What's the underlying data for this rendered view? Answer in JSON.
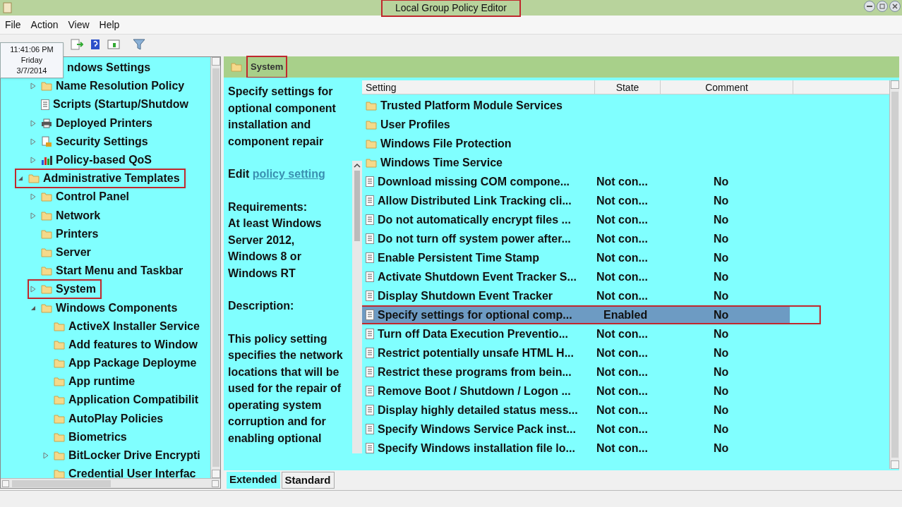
{
  "window": {
    "title": "Local Group Policy Editor",
    "title_highlighted": true
  },
  "menu": [
    "File",
    "Action",
    "View",
    "Help"
  ],
  "clock_tooltip": {
    "time": "11:41:06 PM",
    "day": "Friday",
    "date": "3/7/2014"
  },
  "tree": [
    {
      "label": "ndows Settings",
      "highlighted": false,
      "children": [
        {
          "label": "Name Resolution Policy",
          "kind": "folder",
          "expanded": false,
          "highlighted": false
        },
        {
          "label": "Scripts (Startup/Shutdow",
          "kind": "script",
          "highlighted": false
        },
        {
          "label": "Deployed Printers",
          "kind": "printer",
          "expanded": false,
          "highlighted": false
        },
        {
          "label": "Security Settings",
          "kind": "security",
          "expanded": false,
          "highlighted": false
        },
        {
          "label": "Policy-based QoS",
          "kind": "chart",
          "expanded": false,
          "highlighted": false
        }
      ]
    },
    {
      "label": "Administrative Templates",
      "kind": "folder",
      "expanded": true,
      "highlighted": true,
      "children": [
        {
          "label": "Control Panel",
          "kind": "folder",
          "expanded": false,
          "highlighted": false
        },
        {
          "label": "Network",
          "kind": "folder",
          "expanded": false,
          "highlighted": false
        },
        {
          "label": "Printers",
          "kind": "folder",
          "highlighted": false
        },
        {
          "label": "Server",
          "kind": "folder",
          "highlighted": false
        },
        {
          "label": "Start Menu and Taskbar",
          "kind": "folder",
          "highlighted": false
        },
        {
          "label": "System",
          "kind": "folder",
          "expanded": false,
          "highlighted": true
        },
        {
          "label": "Windows Components",
          "kind": "folder",
          "expanded": true,
          "highlighted": false,
          "children": [
            {
              "label": "ActiveX Installer Service",
              "kind": "folder",
              "highlighted": false
            },
            {
              "label": "Add features to Window",
              "kind": "folder",
              "highlighted": false
            },
            {
              "label": "App Package Deployme",
              "kind": "folder",
              "highlighted": false
            },
            {
              "label": "App runtime",
              "kind": "folder",
              "highlighted": false
            },
            {
              "label": "Application Compatibilit",
              "kind": "folder",
              "highlighted": false
            },
            {
              "label": "AutoPlay Policies",
              "kind": "folder",
              "highlighted": false
            },
            {
              "label": "Biometrics",
              "kind": "folder",
              "highlighted": false
            },
            {
              "label": "BitLocker Drive Encrypti",
              "kind": "folder",
              "expanded": false,
              "highlighted": false
            },
            {
              "label": "Credential User Interfac",
              "kind": "folder",
              "highlighted": false
            }
          ]
        }
      ]
    }
  ],
  "breadcrumb": {
    "label": "System",
    "highlighted": true
  },
  "description": {
    "title": "Specify settings for optional component installation and component repair",
    "edit_prefix": "Edit",
    "edit_link": "policy setting",
    "requirements_label": "Requirements:",
    "requirements": "At least Windows Server 2012, Windows 8 or Windows RT",
    "description_label": "Description:",
    "description": "This policy setting specifies the network locations that will be used for the repair of operating system corruption and for enabling optional"
  },
  "table": {
    "columns": [
      "Setting",
      "State",
      "Comment"
    ],
    "rows": [
      {
        "kind": "folder",
        "setting": "Trusted Platform Module Services",
        "selected": false
      },
      {
        "kind": "folder",
        "setting": "User Profiles",
        "selected": false
      },
      {
        "kind": "folder",
        "setting": "Windows File Protection",
        "selected": false
      },
      {
        "kind": "folder",
        "setting": "Windows Time Service",
        "selected": false
      },
      {
        "kind": "policy",
        "setting": "Download missing COM compone...",
        "state": "Not con...",
        "comment": "No",
        "selected": false
      },
      {
        "kind": "policy",
        "setting": "Allow Distributed Link Tracking cli...",
        "state": "Not con...",
        "comment": "No",
        "selected": false
      },
      {
        "kind": "policy",
        "setting": "Do not automatically encrypt files ...",
        "state": "Not con...",
        "comment": "No",
        "selected": false
      },
      {
        "kind": "policy",
        "setting": "Do not turn off system power after...",
        "state": "Not con...",
        "comment": "No",
        "selected": false
      },
      {
        "kind": "policy",
        "setting": "Enable Persistent Time Stamp",
        "state": "Not con...",
        "comment": "No",
        "selected": false
      },
      {
        "kind": "policy",
        "setting": "Activate Shutdown Event Tracker S...",
        "state": "Not con...",
        "comment": "No",
        "selected": false
      },
      {
        "kind": "policy",
        "setting": "Display Shutdown Event Tracker",
        "state": "Not con...",
        "comment": "No",
        "selected": false
      },
      {
        "kind": "policy",
        "setting": "Specify settings for optional comp...",
        "state": "Enabled",
        "comment": "No",
        "selected": true
      },
      {
        "kind": "policy",
        "setting": "Turn off Data Execution Preventio...",
        "state": "Not con...",
        "comment": "No",
        "selected": false
      },
      {
        "kind": "policy",
        "setting": "Restrict potentially unsafe HTML H...",
        "state": "Not con...",
        "comment": "No",
        "selected": false
      },
      {
        "kind": "policy",
        "setting": "Restrict these programs from bein...",
        "state": "Not con...",
        "comment": "No",
        "selected": false
      },
      {
        "kind": "policy",
        "setting": "Remove Boot / Shutdown / Logon ...",
        "state": "Not con...",
        "comment": "No",
        "selected": false
      },
      {
        "kind": "policy",
        "setting": "Display highly detailed status mess...",
        "state": "Not con...",
        "comment": "No",
        "selected": false
      },
      {
        "kind": "policy",
        "setting": "Specify Windows Service Pack inst...",
        "state": "Not con...",
        "comment": "No",
        "selected": false
      },
      {
        "kind": "policy",
        "setting": "Specify Windows installation file lo...",
        "state": "Not con...",
        "comment": "No",
        "selected": false
      }
    ]
  },
  "view_tabs": [
    {
      "label": "Extended",
      "selected": true
    },
    {
      "label": "Standard",
      "selected": false
    }
  ]
}
